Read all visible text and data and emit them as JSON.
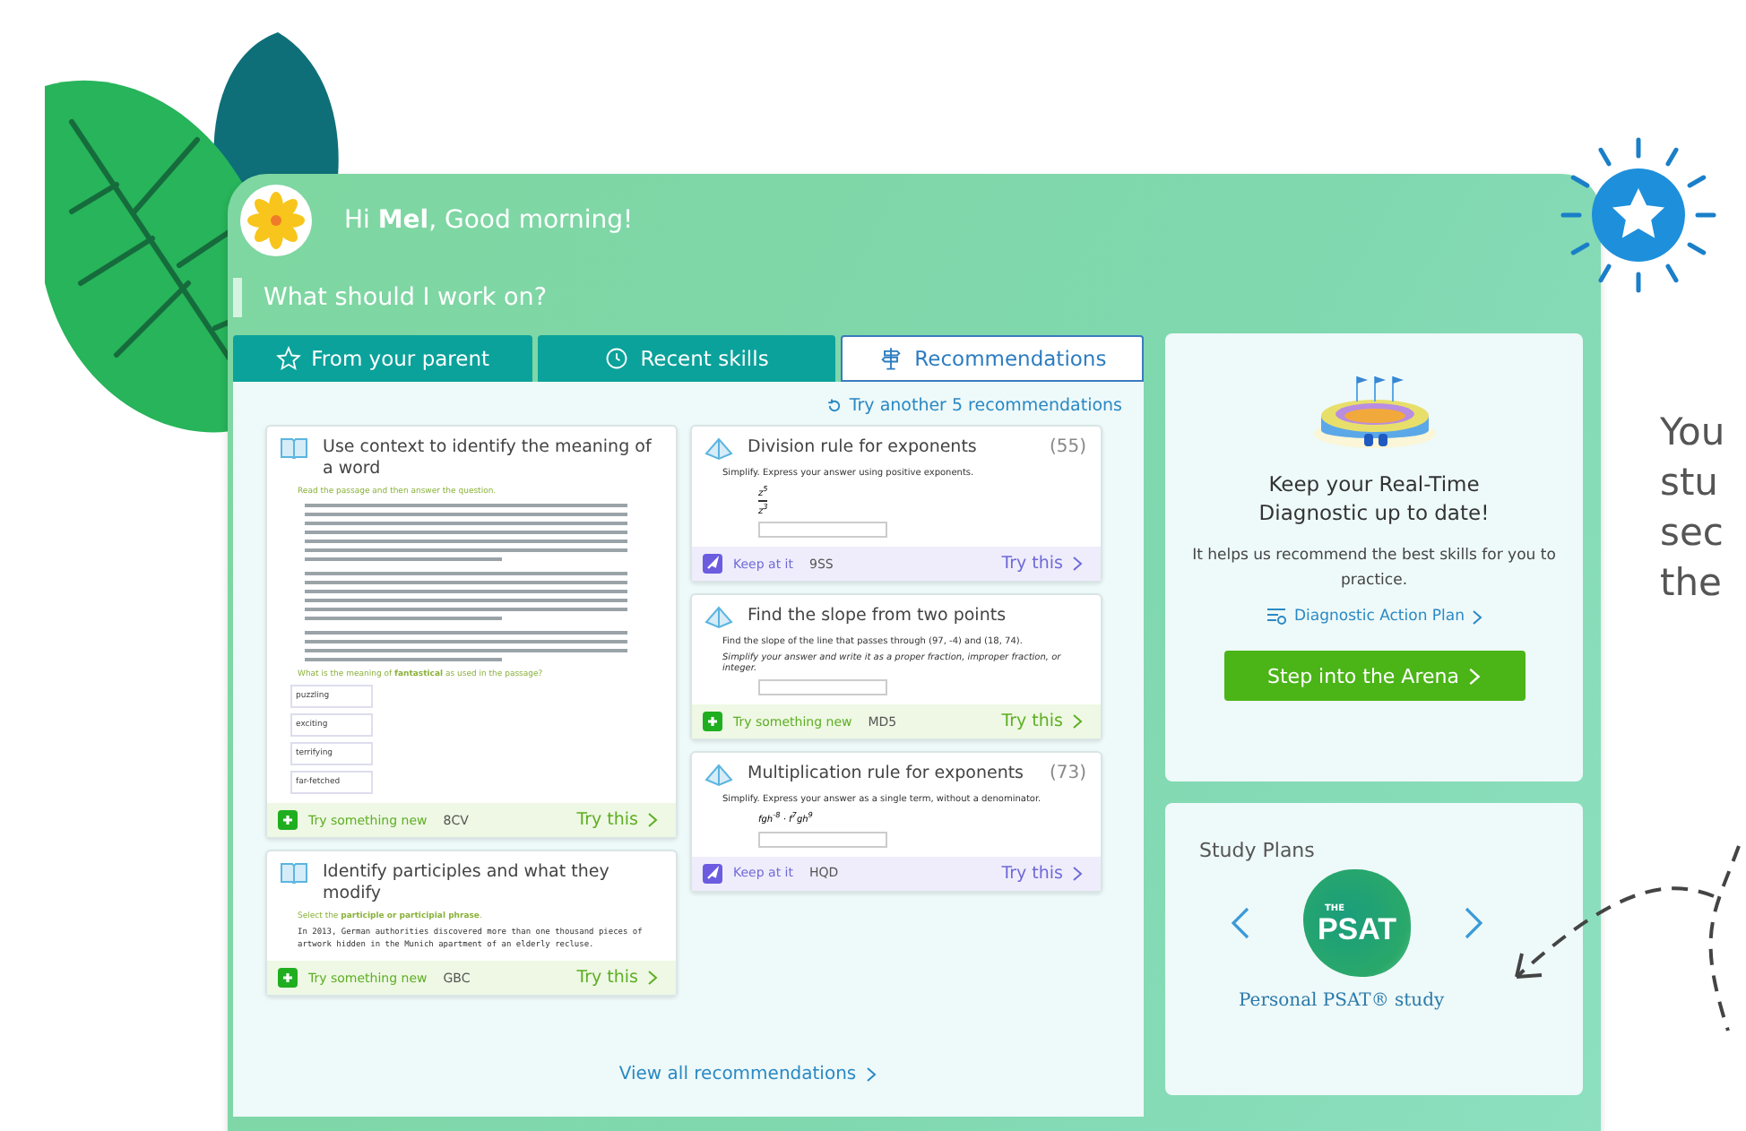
{
  "greeting": "Hi **Mel**, Good morning!",
  "prompt": "What should I work on?",
  "tabs": [
    {
      "label": "From your parent",
      "selected": false
    },
    {
      "label": "Recent skills",
      "selected": false
    },
    {
      "label": "Recommendations",
      "selected": true
    }
  ],
  "refresh_link": "Try another 5 recommendations",
  "columns": [
    [
      {
        "title": "Use context to identify the meaning of a word",
        "kind": "new",
        "tag": "Try something new",
        "code": "8CV",
        "action": "Try this",
        "preview": [
          {
            "kind": "prompt",
            "text": "Read the passage and then answer the question."
          },
          {
            "kind": "passage"
          },
          {
            "kind": "passage"
          },
          {
            "kind": "passage"
          },
          {
            "kind": "prompt",
            "text": "What is the meaning of **fantastical** as used in the passage?"
          },
          {
            "kind": "option",
            "text": "puzzling"
          },
          {
            "kind": "option",
            "text": "exciting"
          },
          {
            "kind": "option",
            "text": "terrifying"
          },
          {
            "kind": "option",
            "text": "far-fetched"
          }
        ]
      },
      {
        "title": "Identify participles and what they modify",
        "kind": "new",
        "tag": "Try something new",
        "code": "GBC",
        "action": "Try this",
        "preview": [
          {
            "kind": "prompt",
            "text": "Select the **participle or participial phrase**."
          },
          {
            "kind": "mono",
            "text": "In 2013, German authorities discovered more than one thousand pieces of artwork hidden in the Munich apartment of an elderly recluse."
          }
        ]
      }
    ],
    [
      {
        "title": "Division rule for exponents",
        "score": "(55)",
        "kind": "keep",
        "tag": "Keep at it",
        "code": "9SS",
        "action": "Try this",
        "preview": [
          {
            "kind": "text",
            "text": "Simplify. Express your answer using positive exponents."
          },
          {
            "kind": "fraction",
            "top": "z$^{5}$",
            "bottom": "z$^{3}$"
          },
          {
            "kind": "blank"
          }
        ]
      },
      {
        "title": "Find the slope from two points",
        "kind": "new",
        "tag": "Try something new",
        "code": "MD5",
        "action": "Try this",
        "preview": [
          {
            "kind": "text",
            "text": "Find the slope of the line that passes through (97, -4) and (18, 74)."
          },
          {
            "kind": "italic",
            "text": "Simplify your answer and write it as a proper fraction, improper fraction, or integer."
          },
          {
            "kind": "blank"
          }
        ]
      },
      {
        "title": "Multiplication rule for exponents",
        "score": "(73)",
        "kind": "keep",
        "tag": "Keep at it",
        "code": "HQD",
        "action": "Try this",
        "preview": [
          {
            "kind": "text",
            "text": "Simplify. Express your answer as a single term, without a denominator."
          },
          {
            "kind": "math",
            "text": "fgh$^{-8}$ · f$^{7}$gh$^{9}$"
          },
          {
            "kind": "blank"
          }
        ]
      }
    ]
  ],
  "view_all": "View all recommendations",
  "diagnostic": {
    "title": "Keep your Real-Time Diagnostic up to date!",
    "text": "It helps us recommend the best skills for you to practice.",
    "link": "Diagnostic Action Plan",
    "button": "Step into the Arena"
  },
  "study_plans": {
    "title": "Study Plans",
    "logo_small": "THE",
    "logo": "PSAT",
    "plan": "Personal PSAT® study"
  },
  "side_text": [
    "You",
    "stu",
    "sec",
    "the"
  ]
}
